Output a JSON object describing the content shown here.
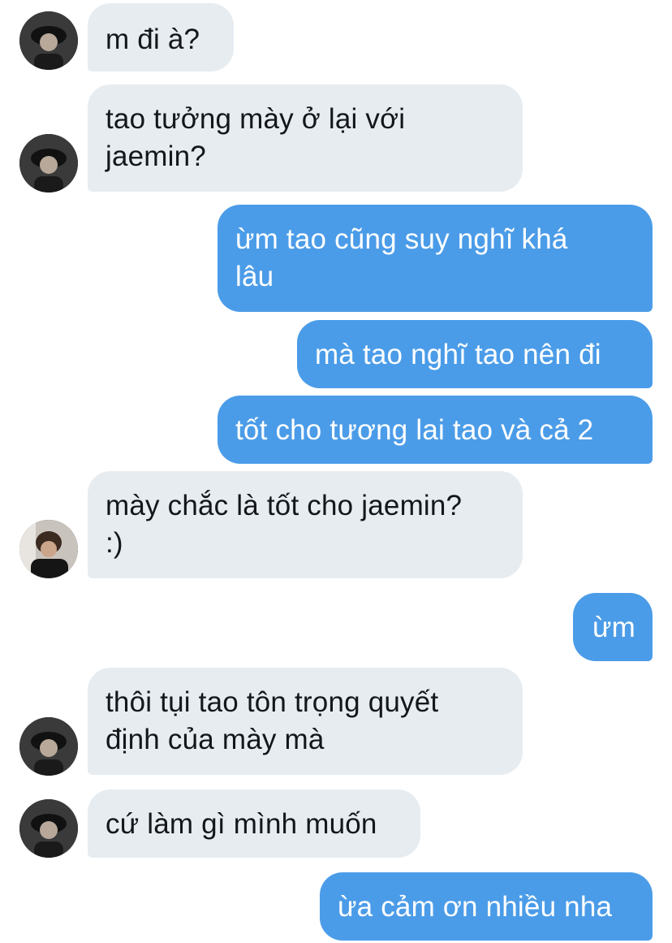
{
  "messages": [
    {
      "side": "in",
      "text": "m đi à?"
    },
    {
      "side": "in",
      "text": "tao tưởng mày ở lại với\njaemin?"
    },
    {
      "side": "out",
      "text": "ừm tao cũng suy nghĩ khá\nlâu"
    },
    {
      "side": "out",
      "text": "mà tao nghĩ tao nên đi"
    },
    {
      "side": "out",
      "text": "tốt cho tương lai tao và cả 2"
    },
    {
      "side": "in",
      "text": "mày chắc là tốt cho jaemin?\n:)"
    },
    {
      "side": "out",
      "text": "ừm"
    },
    {
      "side": "in",
      "text": "thôi tụi tao tôn trọng quyết\nđịnh của mày mà"
    },
    {
      "side": "in",
      "text": "cứ làm gì mình muốn"
    },
    {
      "side": "out",
      "text": "ừa cảm ơn nhiều nha"
    }
  ],
  "colors": {
    "incoming_bubble": "#e6ecf0",
    "outgoing_bubble": "#4b9ce8",
    "incoming_text": "#14171a",
    "outgoing_text": "#ffffff"
  },
  "icons": {
    "avatar": "user-avatar-photo"
  }
}
